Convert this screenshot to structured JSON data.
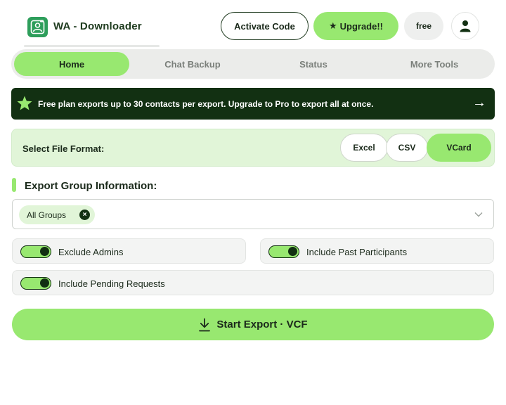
{
  "app": {
    "title": "WA - Downloader",
    "logo_icon": "contacts-app-logo-icon"
  },
  "header": {
    "activate_label": "Activate Code",
    "upgrade_label": "Upgrade!!",
    "upgrade_icon": "star-icon",
    "plan_badge": "free",
    "profile_icon": "user-icon"
  },
  "tabs": [
    {
      "label": "Home",
      "active": true
    },
    {
      "label": "Chat Backup",
      "active": false
    },
    {
      "label": "Status",
      "active": false
    },
    {
      "label": "More Tools",
      "active": false
    }
  ],
  "banner": {
    "icon": "star-icon",
    "text": "Free plan exports up to 30 contacts per export. Upgrade to Pro to export all at once.",
    "arrow": "→"
  },
  "file_format": {
    "label": "Select File Format:",
    "options": [
      "Excel",
      "CSV",
      "VCard"
    ],
    "selected": "VCard"
  },
  "export_group": {
    "title": "Export Group Information:",
    "selected_chip": "All Groups",
    "chip_remove": "×",
    "dropdown_icon": "chevron-down-icon"
  },
  "options": {
    "exclude_admins": {
      "label": "Exclude Admins",
      "enabled": true
    },
    "include_past": {
      "label": "Include Past Participants",
      "enabled": true
    },
    "include_pending": {
      "label": "Include Pending Requests",
      "enabled": true
    }
  },
  "export_button": {
    "label": "Start Export · VCF",
    "icon": "download-icon"
  },
  "colors": {
    "accent_green": "#98e870",
    "dark_green": "#123012",
    "light_green": "#e1f5d8",
    "logo_green": "#2e9e5b"
  }
}
